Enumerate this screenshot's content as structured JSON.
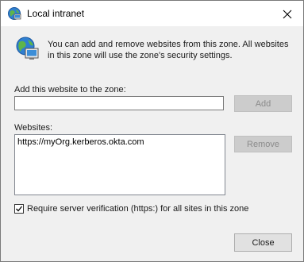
{
  "window": {
    "title": "Local intranet",
    "title_icon": "globe-intranet-icon",
    "close_icon": "close-icon"
  },
  "info": {
    "icon": "globe-monitor-icon",
    "text": "You can add and remove websites from this zone. All websites in this zone will use the zone's security settings."
  },
  "add_site": {
    "label": "Add this website to the zone:",
    "value": "",
    "add_button": "Add"
  },
  "websites": {
    "label": "Websites:",
    "items": [
      "https://myOrg.kerberos.okta.com"
    ],
    "remove_button": "Remove"
  },
  "require_https": {
    "checked": true,
    "label": "Require server verification (https:) for all sites in this zone"
  },
  "footer": {
    "close_button": "Close"
  }
}
